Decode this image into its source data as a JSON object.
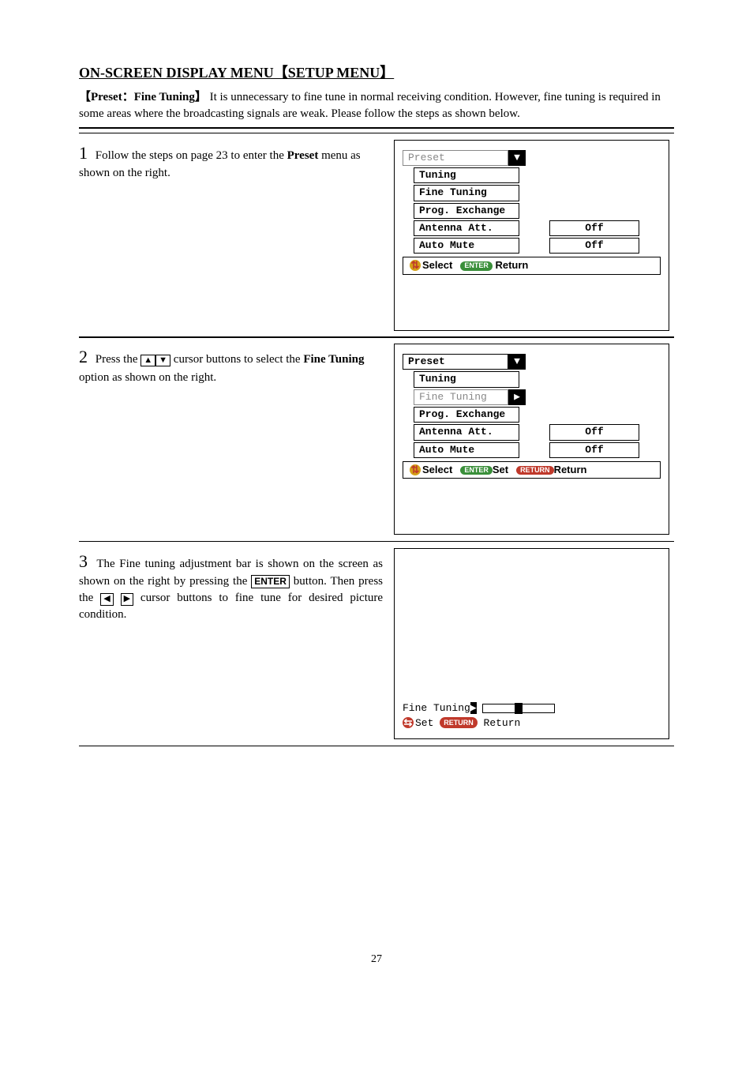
{
  "heading": "ON-SCREEN DISPLAY MENU【SETUP MENU】",
  "intro": {
    "label": "【Preset：Fine Tuning】",
    "text": "It is unnecessary to fine tune in normal receiving condition. However, fine tuning is required in some areas where the broadcasting signals are weak. Please follow the steps as shown below."
  },
  "steps": {
    "s1": {
      "num": "1",
      "text_a": "Follow the steps on page 23 to enter the ",
      "text_b": "Preset",
      "text_c": " menu as shown on the right."
    },
    "s2": {
      "num": "2",
      "text_a": "Press the ",
      "text_b": " cursor buttons to select the ",
      "text_c": "Fine Tuning",
      "text_d": " option as shown on the right."
    },
    "s3": {
      "num": "3",
      "text_a": "The Fine tuning adjustment bar is shown on the screen as shown on the right by pressing the ",
      "text_b": "ENTER",
      "text_c": " button. Then press the ",
      "text_d": " cursor buttons to fine tune for desired picture condition."
    }
  },
  "osd": {
    "title": "Preset",
    "items": {
      "tuning": "Tuning",
      "fine_tuning": "Fine Tuning",
      "prog_exchange": "Prog. Exchange",
      "antenna_att": "Antenna Att.",
      "auto_mute": "Auto Mute"
    },
    "values": {
      "off": "Off"
    },
    "bar": {
      "select": "Select",
      "set": "Set",
      "return": "Return",
      "enter_pill": "ENTER",
      "return_pill": "RETURN"
    }
  },
  "page": "27"
}
